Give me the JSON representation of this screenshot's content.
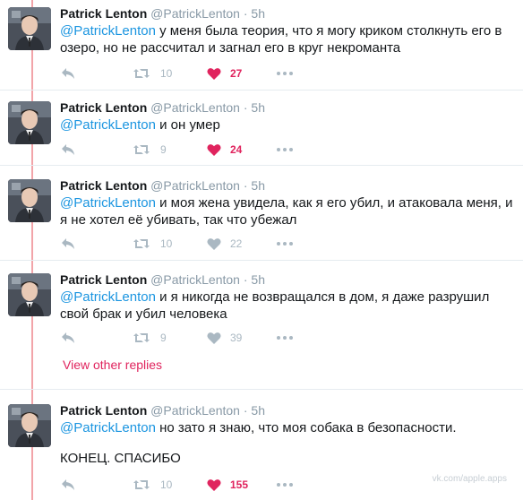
{
  "tweets": [
    {
      "name": "Patrick Lenton",
      "handle": "@PatrickLenton",
      "time": "5h",
      "mention": "@PatrickLenton",
      "text": " у меня была теория, что я могу криком столкнуть его в озеро, но не рассчитал и загнал его в круг некроманта",
      "retweets": "10",
      "likes": "27",
      "liked": true
    },
    {
      "name": "Patrick Lenton",
      "handle": "@PatrickLenton",
      "time": "5h",
      "mention": "@PatrickLenton",
      "text": " и он умер",
      "retweets": "9",
      "likes": "24",
      "liked": true
    },
    {
      "name": "Patrick Lenton",
      "handle": "@PatrickLenton",
      "time": "5h",
      "mention": "@PatrickLenton",
      "text": " и моя жена увидела, как я его убил, и атаковала меня, и я не хотел её убивать, так что убежал",
      "retweets": "10",
      "likes": "22",
      "liked": false
    },
    {
      "name": "Patrick Lenton",
      "handle": "@PatrickLenton",
      "time": "5h",
      "mention": "@PatrickLenton",
      "text": " и я никогда не возвращался в дом, я даже разрушил свой брак и убил человека",
      "retweets": "9",
      "likes": "39",
      "liked": false
    },
    {
      "name": "Patrick Lenton",
      "handle": "@PatrickLenton",
      "time": "5h",
      "mention": "@PatrickLenton",
      "text": " но зато я знаю, что моя собака в безопасности.",
      "extra": "КОНЕЦ. СПАСИБО",
      "retweets": "10",
      "likes": "155",
      "liked": true
    }
  ],
  "view_replies": "View other replies",
  "watermark": "vk.com/apple.apps",
  "icons": {
    "reply": "reply-icon",
    "retweet": "retweet-icon",
    "like": "heart-icon",
    "more": "more-icon"
  },
  "colors": {
    "like_active": "#e0245e",
    "mention": "#1b95e0",
    "muted": "#aab8c2",
    "thread_line": "#f2a4a9"
  }
}
